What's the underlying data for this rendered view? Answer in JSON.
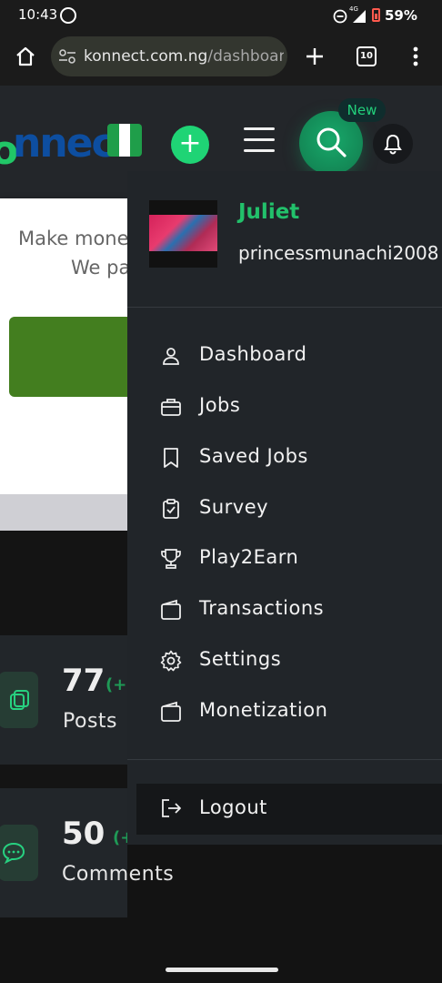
{
  "status_bar": {
    "time": "10:43",
    "network": "4G",
    "battery": "59%"
  },
  "browser": {
    "url_host": "konnect.com.ng",
    "url_path": "/dashboar",
    "tab_count": "10"
  },
  "header": {
    "logo_text": "nnect",
    "new_badge": "New"
  },
  "promo": {
    "line1": "Make mone",
    "line2": "We pa"
  },
  "stats": [
    {
      "value": "77",
      "delta": "(+",
      "label": "Posts"
    },
    {
      "value": "50",
      "delta": "(+",
      "label": "Comments"
    }
  ],
  "profile": {
    "name": "Juliet",
    "email": "princessmunachi2008"
  },
  "menu": [
    {
      "label": "Dashboard",
      "icon": "user-icon"
    },
    {
      "label": "Jobs",
      "icon": "briefcase-icon"
    },
    {
      "label": "Saved Jobs",
      "icon": "bookmark-icon"
    },
    {
      "label": "Survey",
      "icon": "clipboard-check-icon"
    },
    {
      "label": "Play2Earn",
      "icon": "trophy-icon"
    },
    {
      "label": "Transactions",
      "icon": "wallet-icon"
    },
    {
      "label": "Settings",
      "icon": "gear-icon"
    },
    {
      "label": "Monetization",
      "icon": "wallet-icon"
    }
  ],
  "logout": {
    "label": "Logout",
    "icon": "logout-icon"
  },
  "colors": {
    "accent": "#22c16b",
    "drawer_bg": "#212529",
    "logo_blue": "#0d4ea0",
    "promo_button": "#437e1f"
  }
}
